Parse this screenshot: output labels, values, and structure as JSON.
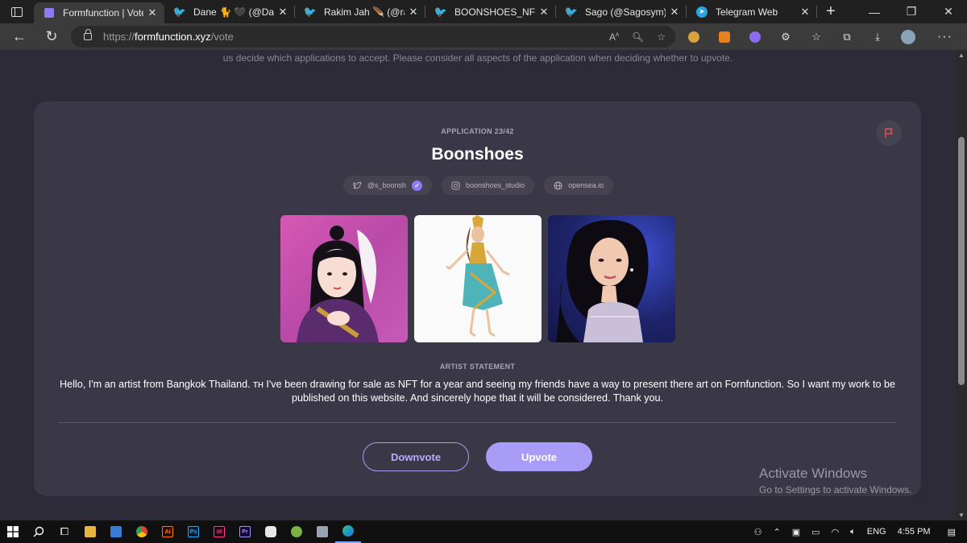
{
  "browser": {
    "tabs": [
      {
        "label": "Formfunction | Vote",
        "icon": "formfunction-icon",
        "active": true
      },
      {
        "label": "Dane 🐈 🖤 (@Danelli",
        "icon": "twitter-icon",
        "active": false
      },
      {
        "label": "Rakim Jah 🪶 (@rakim",
        "icon": "twitter-icon",
        "active": false
      },
      {
        "label": "BOONSHOES_NFT (@",
        "icon": "twitter-icon",
        "active": false
      },
      {
        "label": "Sago (@Sagosym) / Tw",
        "icon": "twitter-icon",
        "active": false
      },
      {
        "label": "Telegram Web",
        "icon": "telegram-icon",
        "active": false
      }
    ],
    "url": {
      "proto": "https://",
      "host": "formfunction.xyz",
      "path": "/vote"
    }
  },
  "page": {
    "intro": "us decide which applications to accept. Please consider all aspects of the application when deciding whether to upvote.",
    "application_count": "APPLICATION 23/42",
    "artist_name": "Boonshoes",
    "socials": [
      {
        "label": "@s_boonsh",
        "icon": "twitter-icon",
        "verified": true
      },
      {
        "label": "boonshoes_studio",
        "icon": "instagram-icon",
        "verified": false
      },
      {
        "label": "opensea.io",
        "icon": "globe-icon",
        "verified": false
      }
    ],
    "statement_label": "ARTIST STATEMENT",
    "statement": "Hello, I'm an artist from Bangkok Thailand. ᴛʜ I've been drawing for sale as NFT for a year and seeing my friends have a way to present there art on Fornfunction. So I want my work to be published on this website. And sincerely hope that it will be considered. Thank you.",
    "downvote_label": "Downvote",
    "upvote_label": "Upvote"
  },
  "watermark": {
    "line1": "Activate Windows",
    "line2": "Go to Settings to activate Windows."
  },
  "taskbar": {
    "lang": "ENG",
    "time": "4:55 PM"
  },
  "colors": {
    "accent": "#a99cf6",
    "card": "#3a3847",
    "background": "#2d2b38"
  }
}
